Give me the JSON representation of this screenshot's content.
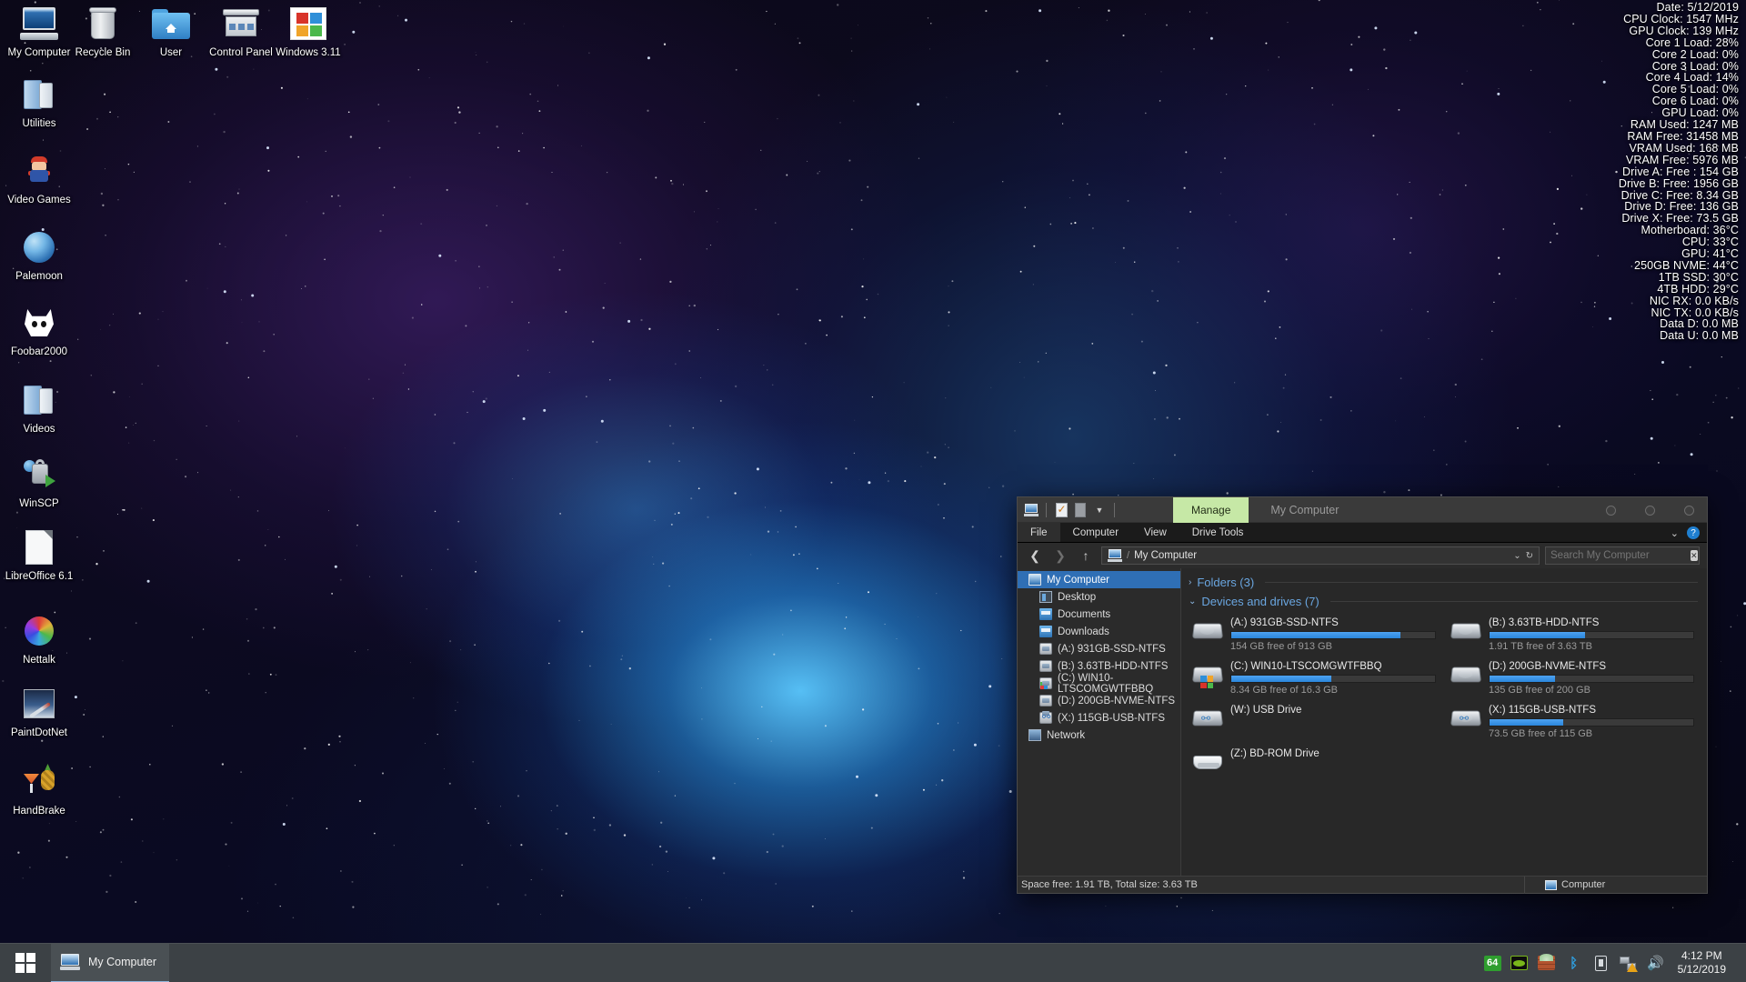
{
  "desktop": {
    "icons": [
      {
        "label": "My Computer",
        "icon": "my-computer-icon"
      },
      {
        "label": "Recycle Bin",
        "icon": "recycle-bin-icon"
      },
      {
        "label": "User",
        "icon": "user-folder-icon"
      },
      {
        "label": "Control Panel",
        "icon": "control-panel-icon"
      },
      {
        "label": "Windows 3.11",
        "icon": "windows-311-icon"
      },
      {
        "label": "Utilities",
        "icon": "utilities-folder-icon"
      },
      {
        "label": "Video Games",
        "icon": "video-games-icon"
      },
      {
        "label": "Palemoon",
        "icon": "palemoon-icon"
      },
      {
        "label": "Foobar2000",
        "icon": "foobar2000-icon"
      },
      {
        "label": "Videos",
        "icon": "videos-folder-icon"
      },
      {
        "label": "WinSCP",
        "icon": "winscp-icon"
      },
      {
        "label": "LibreOffice 6.1",
        "icon": "libreoffice-icon"
      },
      {
        "label": "Nettalk",
        "icon": "nettalk-icon"
      },
      {
        "label": "PaintDotNet",
        "icon": "paintdotnet-icon"
      },
      {
        "label": "HandBrake",
        "icon": "handbrake-icon"
      }
    ]
  },
  "hwmonitor": {
    "rows": [
      "Date: 5/12/2019",
      "CPU Clock: 1547 MHz",
      "GPU Clock: 139 MHz",
      "Core 1 Load: 28%",
      "Core 2 Load: 0%",
      "Core 3 Load: 0%",
      "Core 4 Load: 14%",
      "Core 5 Load: 0%",
      "Core 6 Load: 0%",
      "GPU Load: 0%",
      "RAM Used: 1247 MB",
      "RAM Free: 31458 MB",
      "VRAM Used: 168 MB",
      "VRAM Free: 5976 MB",
      "Drive A: Free : 154 GB",
      "Drive B: Free: 1956 GB",
      "Drive C: Free: 8.34 GB",
      "Drive D: Free: 136 GB",
      "Drive X: Free: 73.5 GB",
      "Motherboard: 36°C",
      "CPU: 33°C",
      "GPU: 41°C",
      "250GB NVME: 44°C",
      "1TB SSD: 30°C",
      "4TB HDD: 29°C",
      "NIC RX: 0.0 KB/s",
      "NIC TX: 0.0 KB/s",
      "Data D: 0.0 MB",
      "Data U: 0.0 MB"
    ]
  },
  "explorer": {
    "title": "My Computer",
    "manage_tab": "Manage",
    "ribbon_tabs": [
      "File",
      "Computer",
      "View",
      "Drive Tools"
    ],
    "address": {
      "crumb": "My Computer",
      "separator": "/"
    },
    "search": {
      "placeholder": "Search My Computer",
      "value": ""
    },
    "nav_tree": [
      {
        "label": "My Computer",
        "icon": "computer-icon",
        "selected": true
      },
      {
        "label": "Desktop",
        "icon": "desktop-icon",
        "selected": false
      },
      {
        "label": "Documents",
        "icon": "documents-folder-icon",
        "selected": false
      },
      {
        "label": "Downloads",
        "icon": "downloads-folder-icon",
        "selected": false
      },
      {
        "label": "(A:) 931GB-SSD-NTFS",
        "icon": "drive-icon",
        "selected": false
      },
      {
        "label": "(B:) 3.63TB-HDD-NTFS",
        "icon": "drive-icon",
        "selected": false
      },
      {
        "label": "(C:) WIN10-LTSCOMGWTFBBQ",
        "icon": "windows-drive-icon",
        "selected": false
      },
      {
        "label": "(D:) 200GB-NVME-NTFS",
        "icon": "drive-icon",
        "selected": false
      },
      {
        "label": "(X:) 115GB-USB-NTFS",
        "icon": "usb-drive-icon",
        "selected": false
      },
      {
        "label": "Network",
        "icon": "network-icon",
        "selected": false
      }
    ],
    "groups": {
      "folders": {
        "label": "Folders (3)",
        "expanded": false,
        "arrow": "›"
      },
      "devices": {
        "label": "Devices and drives (7)",
        "expanded": true,
        "arrow": "⌄"
      }
    },
    "drives": [
      {
        "name": "(A:) 931GB-SSD-NTFS",
        "free_text": "154 GB free of 913 GB",
        "used_pct": 83,
        "icon": "hard-drive-icon"
      },
      {
        "name": "(B:) 3.63TB-HDD-NTFS",
        "free_text": "1.91 TB free of 3.63 TB",
        "used_pct": 47,
        "icon": "hard-drive-icon"
      },
      {
        "name": "(C:) WIN10-LTSCOMGWTFBBQ",
        "free_text": "8.34 GB free of 16.3 GB",
        "used_pct": 49,
        "icon": "windows-drive-icon"
      },
      {
        "name": "(D:) 200GB-NVME-NTFS",
        "free_text": "135 GB free of 200 GB",
        "used_pct": 32,
        "icon": "hard-drive-icon"
      },
      {
        "name": "(W:) USB Drive",
        "free_text": "",
        "used_pct": 0,
        "icon": "usb-drive-icon"
      },
      {
        "name": "(X:) 115GB-USB-NTFS",
        "free_text": "73.5 GB free of 115 GB",
        "used_pct": 36,
        "icon": "usb-drive-icon"
      },
      {
        "name": "(Z:) BD-ROM Drive",
        "free_text": "",
        "used_pct": 0,
        "icon": "optical-drive-icon"
      }
    ],
    "statusbar": {
      "left": "Space free: 1.91 TB, Total size: 3.63 TB",
      "right": "Computer"
    }
  },
  "taskbar": {
    "start_label": "start-button",
    "items": [
      {
        "label": "My Computer",
        "icon": "my-computer-icon",
        "active": true
      }
    ],
    "tray": [
      {
        "name": "64-bit-indicator-icon",
        "glyph": "64"
      },
      {
        "name": "nvidia-icon",
        "glyph": ""
      },
      {
        "name": "firewall-icon",
        "glyph": ""
      },
      {
        "name": "bluetooth-icon",
        "glyph": ""
      },
      {
        "name": "usb-eject-icon",
        "glyph": ""
      },
      {
        "name": "network-warning-icon",
        "glyph": ""
      },
      {
        "name": "volume-icon",
        "glyph": "🔊"
      }
    ],
    "clock": {
      "time": "4:12 PM",
      "date": "5/12/2019"
    }
  },
  "colors": {
    "accent_blue": "#2f6fb5",
    "drive_bar": "#3a90e8",
    "manage_tab": "#c6e8a6",
    "group_header": "#6aa6e0",
    "taskbar": "#3c4145"
  }
}
